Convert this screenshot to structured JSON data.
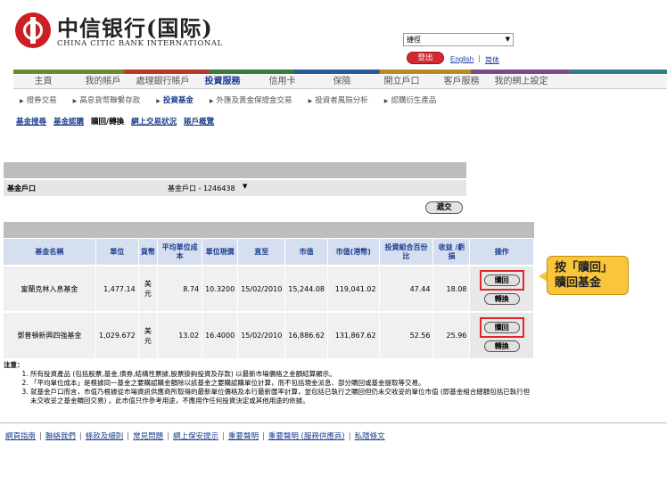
{
  "brand": {
    "name_cn": "中信银行(国际)",
    "name_en": "CHINA CITIC BANK INTERNATIONAL",
    "red": "#cc1f25"
  },
  "header": {
    "language_select": "捷徑",
    "logout": "登出",
    "english": "English",
    "separator": "|",
    "simplified": "简体"
  },
  "main_nav": [
    "主頁",
    "我的賬戶",
    "處理銀行賬戶",
    "投資服務",
    "信用卡",
    "保險",
    "開立戶口",
    "客戶服務",
    "我的網上設定"
  ],
  "main_nav_active": 3,
  "sub_nav": [
    "證券交易",
    "高息貨幣聯繫存款",
    "投資基金",
    "外匯及黃金保證金交易",
    "投資者風險分析",
    "認購衍生產品"
  ],
  "sub_nav_active": 2,
  "tabs": [
    "基金搜尋",
    "基金認購",
    "贖回/轉換",
    "網上交易狀況",
    "賬戶概覽"
  ],
  "tabs_current": 2,
  "account": {
    "label": "基金戶口",
    "value": "基金戶口 - 1246438"
  },
  "submit": "遞交",
  "table": {
    "headers": [
      "基金名稱",
      "單位",
      "貨幣",
      "平均單位成本",
      "單位現價",
      "直至",
      "市值",
      "市值(港幣)",
      "投資組合百份比",
      "收益 /虧損",
      "操作"
    ],
    "rows": [
      {
        "name": "富蘭克林入息基金",
        "units": "1,477.14",
        "currency": "美元",
        "avg_cost": "8.74",
        "price": "10.3200",
        "date": "15/02/2010",
        "market_value": "15,244.08",
        "market_value_hkd": "119,041.02",
        "portfolio_pct": "47.44",
        "gain_loss": "18.08",
        "redeem": "贖回",
        "switch": "轉換"
      },
      {
        "name": "鄧普頓新興四強基金",
        "units": "1,029.672",
        "currency": "美元",
        "avg_cost": "13.02",
        "price": "16.4000",
        "date": "15/02/2010",
        "market_value": "16,886.62",
        "market_value_hkd": "131,867.62",
        "portfolio_pct": "52.56",
        "gain_loss": "25.96",
        "redeem": "贖回",
        "switch": "轉換"
      }
    ]
  },
  "callout": "按「贖回」贖回基金",
  "notes": {
    "title": "注意：",
    "items": [
      "所有投資產品 (包括股票,基金,債券,結構性票據,股票掛鈎投資及存款) 以最新市場價格之金額結算顯示。",
      "「平均單位成本」是根據同一基金之要購認購金額除以該基金之要購認購單位計算，而不包括現金派息、部分贖回或基金提取等交易。",
      "就基金戶口而言，市值乃根據從市場資訊供應商所取得的最新單位價格及本行最新匯率計算，並包括已執行之贖回但仍未交收妥的單位市值 (即基金組合總額包括已執行但未交收妥之基金贖回交易) 。此市值只作參考用途，不應用作任何投資決定或其他用途的依據。"
    ]
  },
  "footer": [
    "網頁指南",
    "聯絡我們",
    "條款及細則",
    "常見問題",
    "網上保安提示",
    "重要聲明",
    "重要聲明 (服務供應商)",
    "私隱條文"
  ]
}
